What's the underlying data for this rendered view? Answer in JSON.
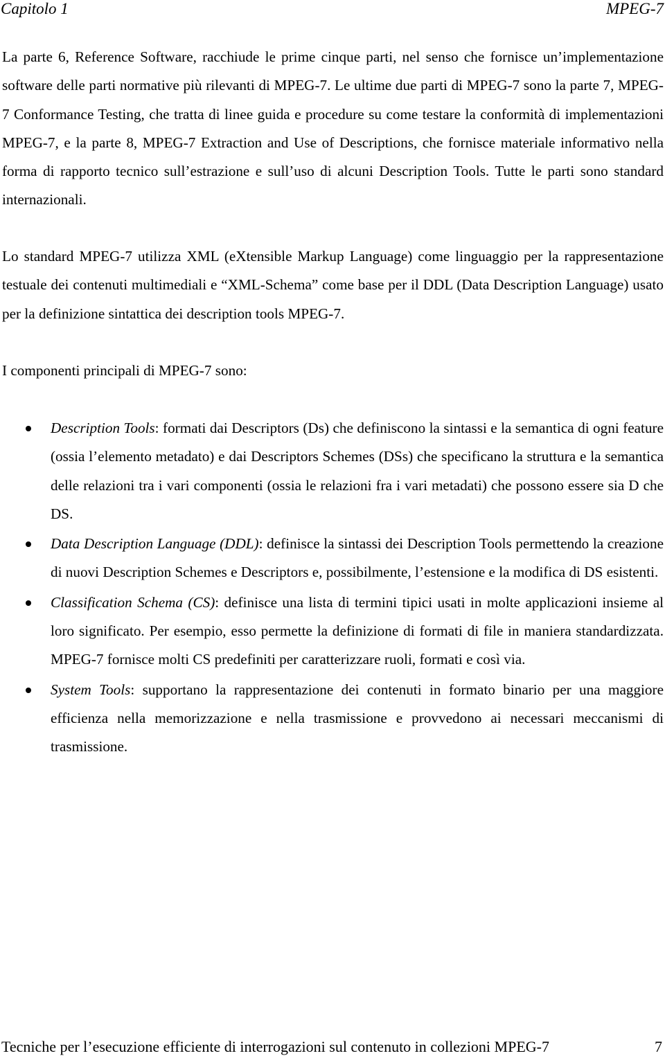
{
  "header": {
    "chapter": "Capitolo 1",
    "section": "MPEG-7"
  },
  "paragraphs": [
    "La parte 6, Reference Software, racchiude le prime cinque parti, nel senso che fornisce un’implementazione software delle parti normative più rilevanti di MPEG-7. Le ultime due parti di MPEG-7 sono la parte 7, MPEG-7 Conformance Testing, che tratta di linee guida e procedure su come testare la conformità di implementazioni MPEG-7, e la parte 8, MPEG-7 Extraction and Use of Descriptions, che fornisce materiale informativo nella forma di rapporto tecnico sull’estrazione e sull’uso di alcuni Description Tools. Tutte le parti sono standard internazionali.",
    "Lo standard MPEG-7 utilizza XML (eXtensible Markup Language) come linguaggio per la rappresentazione testuale dei contenuti multimediali e “XML-Schema” come base per il DDL (Data Description Language) usato per la definizione sintattica dei description tools MPEG-7.",
    "I componenti principali di MPEG-7 sono:"
  ],
  "components": [
    {
      "term": "Description Tools",
      "separator": ":",
      "text": " formati dai Descriptors (Ds) che definiscono la sintassi e la semantica di ogni feature (ossia l’elemento metadato) e dai Descriptors Schemes (DSs) che specificano la struttura e la semantica delle relazioni tra i vari componenti (ossia le relazioni fra i vari metadati) che possono essere sia D che DS."
    },
    {
      "term": "Data Description Language (DDL)",
      "separator": ":",
      "text": " definisce la sintassi dei Description Tools permettendo la creazione di nuovi Description Schemes e Descriptors e, possibilmente, l’estensione e la modifica di DS esistenti."
    },
    {
      "term": "Classification Schema (CS)",
      "separator": ":",
      "text": " definisce una lista di termini tipici usati in molte applicazioni insieme al loro significato. Per esempio, esso permette la definizione di formati di file in maniera standardizzata. MPEG-7 fornisce molti CS predefiniti per caratterizzare ruoli, formati e così via."
    },
    {
      "term": "System Tools",
      "separator": ":",
      "text": " supportano la rappresentazione dei contenuti in formato binario per una maggiore efficienza nella memorizzazione e nella trasmissione e provvedono ai necessari meccanismi di trasmissione."
    }
  ],
  "footer": {
    "title": "Tecniche per l’esecuzione efficiente di interrogazioni sul contenuto in collezioni MPEG-7",
    "page_number": "7"
  }
}
